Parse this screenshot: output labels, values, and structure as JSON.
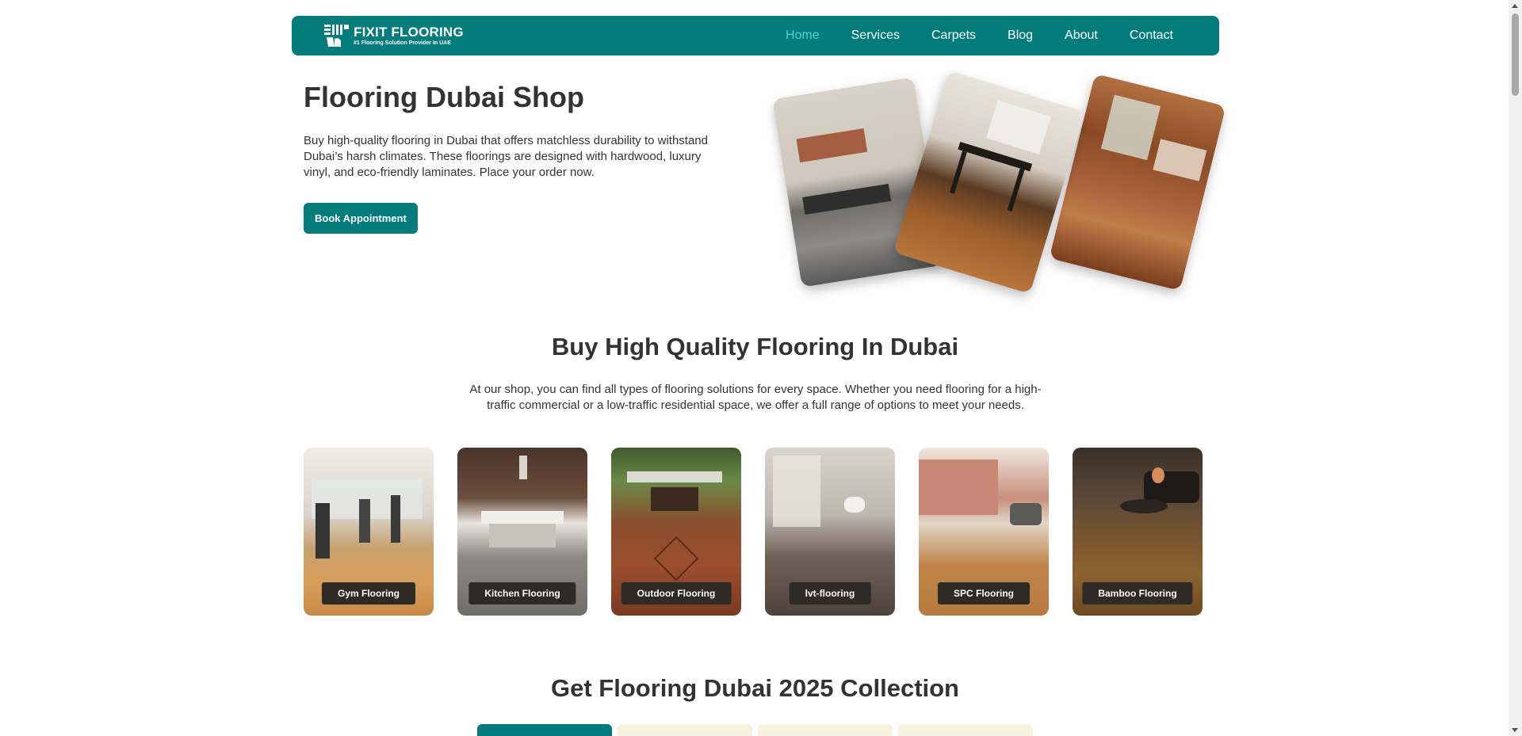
{
  "brand": {
    "name": "FIXIT FLOORING",
    "tagline": "#1 Flooring Solution Provider In UAE"
  },
  "nav": {
    "items": [
      {
        "label": "Home",
        "active": true
      },
      {
        "label": "Services",
        "active": false
      },
      {
        "label": "Carpets",
        "active": false
      },
      {
        "label": "Blog",
        "active": false
      },
      {
        "label": "About",
        "active": false
      },
      {
        "label": "Contact",
        "active": false
      }
    ]
  },
  "hero": {
    "title": "Flooring Dubai Shop",
    "text": "Buy high-quality flooring in Dubai that offers matchless durability to withstand Dubai’s harsh climates. These floorings are designed with hardwood, luxury vinyl, and eco-friendly laminates. Place your order now.",
    "button": "Book Appointment"
  },
  "section": {
    "title": "Buy High Quality Flooring In Dubai",
    "text": "At our shop, you can find all types of flooring solutions for every space. Whether you need flooring for a high-traffic commercial or a low-traffic residential space, we offer a full range of options to meet your needs."
  },
  "cards": [
    {
      "label": "Gym Flooring"
    },
    {
      "label": "Kitchen Flooring"
    },
    {
      "label": "Outdoor Flooring"
    },
    {
      "label": "lvt-flooring"
    },
    {
      "label": "SPC Flooring"
    },
    {
      "label": "Bamboo Flooring"
    }
  ],
  "collection": {
    "title": "Get Flooring Dubai 2025 Collection"
  },
  "colors": {
    "primary": "#047c7c",
    "nav_active": "#4fd1d1",
    "tab_inactive": "#f6f2dc",
    "label_bg": "#2e2a26"
  }
}
